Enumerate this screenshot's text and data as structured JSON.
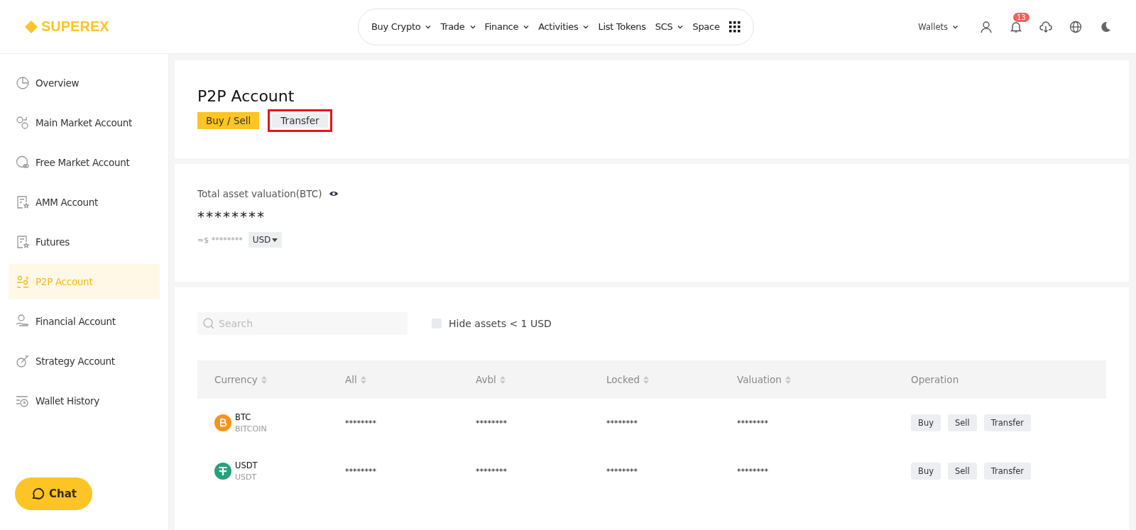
{
  "header": {
    "logo": "SUPEREX",
    "nav": [
      {
        "label": "Buy Crypto",
        "dropdown": true
      },
      {
        "label": "Trade",
        "dropdown": true
      },
      {
        "label": "Finance",
        "dropdown": true
      },
      {
        "label": "Activities",
        "dropdown": true
      },
      {
        "label": "List Tokens",
        "dropdown": false
      },
      {
        "label": "SCS",
        "dropdown": true
      },
      {
        "label": "Space",
        "dropdown": false
      }
    ],
    "wallets": "Wallets",
    "notification_count": "13"
  },
  "sidebar": {
    "items": [
      {
        "label": "Overview",
        "selected": false
      },
      {
        "label": "Main Market Account",
        "selected": false
      },
      {
        "label": "Free Market Account",
        "selected": false
      },
      {
        "label": "AMM Account",
        "selected": false
      },
      {
        "label": "Futures",
        "selected": false
      },
      {
        "label": "P2P Account",
        "selected": true
      },
      {
        "label": "Financial Account",
        "selected": false
      },
      {
        "label": "Strategy Account",
        "selected": false
      },
      {
        "label": "Wallet History",
        "selected": false
      }
    ],
    "chat": "Chat"
  },
  "account": {
    "title": "P2P Account",
    "tabs": [
      {
        "label": "Buy / Sell",
        "selected": true,
        "highlighted": false
      },
      {
        "label": "Transfer",
        "selected": false,
        "highlighted": true
      }
    ]
  },
  "valuation": {
    "label": "Total asset valuation(BTC)",
    "value": "********",
    "approx": "≈$ ********",
    "currency": "USD"
  },
  "assets": {
    "search": {
      "placeholder": "Search"
    },
    "hide_small": {
      "label": "Hide assets < 1 USD",
      "checked": false
    },
    "columns": [
      {
        "label": "Currency",
        "sortable": true
      },
      {
        "label": "All",
        "sortable": true
      },
      {
        "label": "Avbl",
        "sortable": true
      },
      {
        "label": "Locked",
        "sortable": true
      },
      {
        "label": "Valuation",
        "sortable": true
      },
      {
        "label": "Operation",
        "sortable": false
      }
    ],
    "rows": [
      {
        "symbol": "BTC",
        "name": "BITCOIN",
        "kind": "btc",
        "all": "********",
        "avbl": "********",
        "locked": "********",
        "valuation": "********",
        "actions": [
          "Buy",
          "Sell",
          "Transfer"
        ]
      },
      {
        "symbol": "USDT",
        "name": "USDT",
        "kind": "usdt",
        "all": "********",
        "avbl": "********",
        "locked": "********",
        "valuation": "********",
        "actions": [
          "Buy",
          "Sell",
          "Transfer"
        ]
      }
    ]
  }
}
